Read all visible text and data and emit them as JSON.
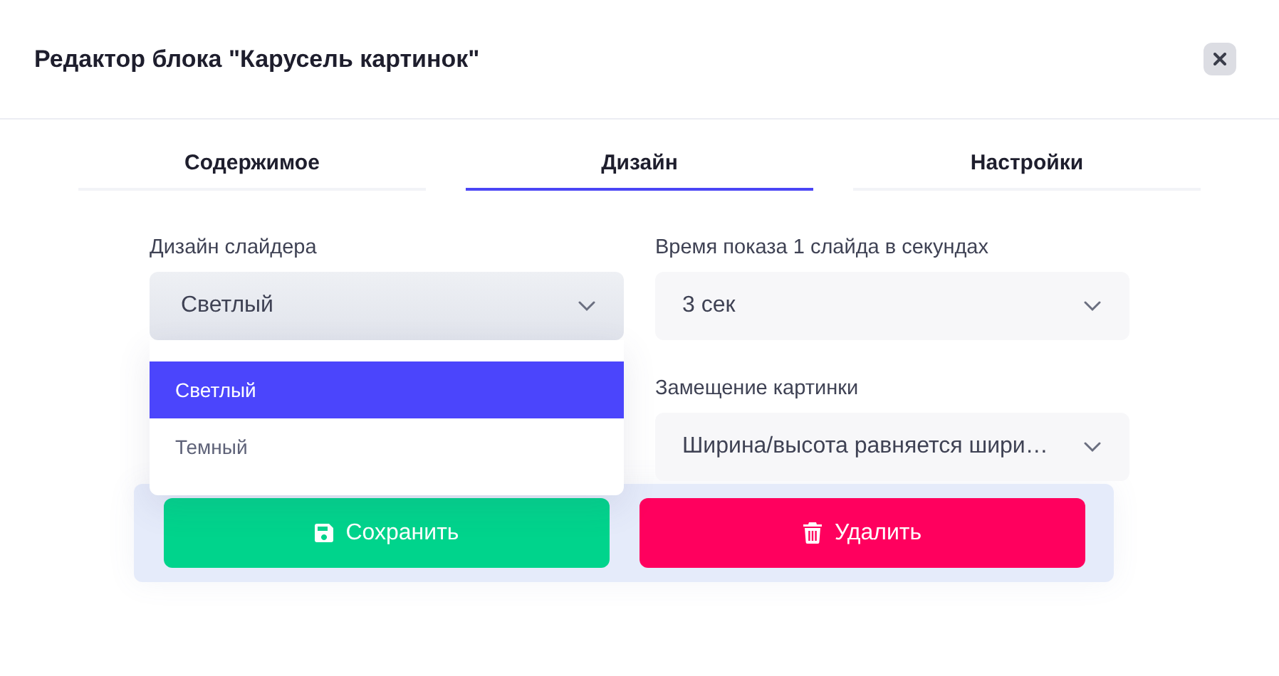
{
  "dialog": {
    "title": "Редактор блока \"Карусель картинок\""
  },
  "tabs": [
    {
      "label": "Содержимое",
      "selected": false
    },
    {
      "label": "Дизайн",
      "selected": true
    },
    {
      "label": "Настройки",
      "selected": false
    }
  ],
  "form": {
    "columns": [
      {
        "fields": [
          {
            "label": "Дизайн слайдера",
            "value": "Светлый",
            "open": true,
            "options": [
              {
                "label": "Светлый",
                "selected": true
              },
              {
                "label": "Темный",
                "selected": false
              }
            ]
          }
        ]
      },
      {
        "fields": [
          {
            "label": "Время показа 1 слайда в секундах",
            "value": "3 сек",
            "open": false
          },
          {
            "label": "Замещение картинки",
            "value": "Ширина/высота равняется шири…",
            "open": false
          }
        ]
      }
    ]
  },
  "buttons": [
    {
      "label": "Сохранить",
      "kind": "save"
    },
    {
      "label": "Удалить",
      "kind": "delete"
    }
  ]
}
